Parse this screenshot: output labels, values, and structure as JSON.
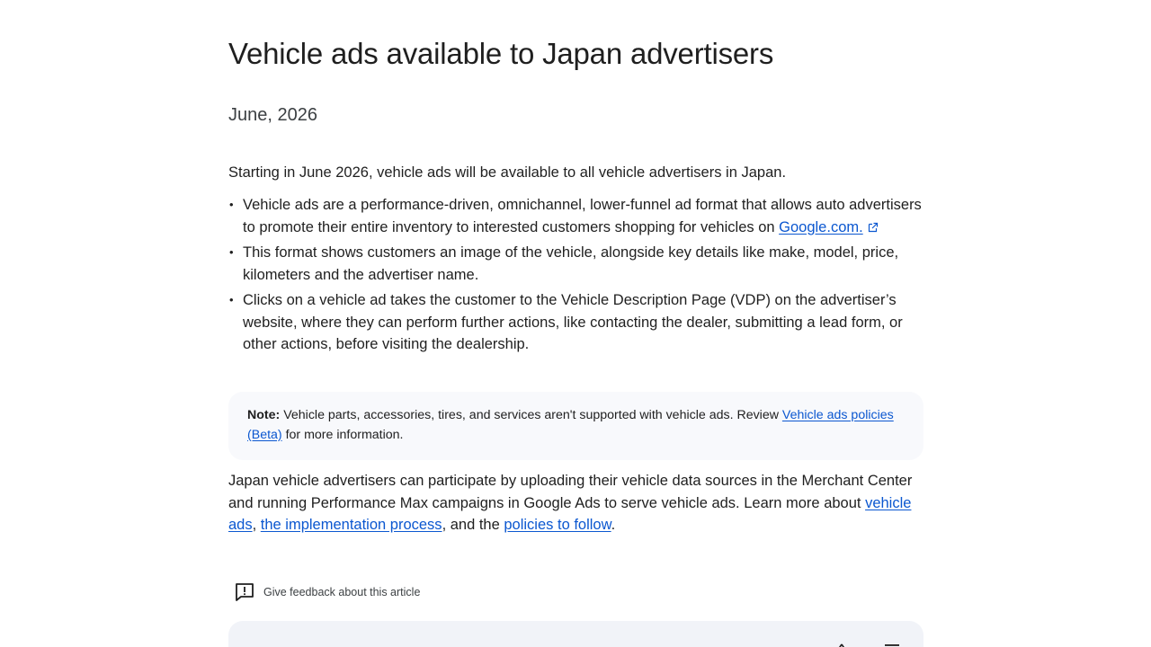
{
  "article": {
    "title": "Vehicle ads available to Japan advertisers",
    "date": "June, 2026",
    "intro": "Starting in June 2026, vehicle ads will be available to all vehicle advertisers in Japan.",
    "bullets": [
      {
        "text": "Vehicle ads are a performance-driven, omnichannel, lower-funnel ad format that allows auto advertisers to promote their entire inventory to interested customers shopping for vehicles on ",
        "link": "Google.com."
      },
      {
        "text": "This format shows customers an image of the vehicle, alongside key details like make, model, price, kilometers and the advertiser name."
      },
      {
        "text": "Clicks on a vehicle ad takes the customer to the Vehicle Description Page (VDP) on the advertiser’s website, where they can perform further actions, like contacting the dealer, submitting a lead form, or other actions, before visiting the dealership."
      }
    ],
    "note": {
      "label": "Note:",
      "text": " Vehicle parts, accessories, tires, and services aren't supported with vehicle ads. Review ",
      "link": "Vehicle ads policies (Beta)",
      "suffix": " for more information."
    },
    "closing": {
      "text1": "Japan vehicle advertisers can participate by uploading their vehicle data sources in the Merchant Center and running Performance Max campaigns in Google Ads to serve vehicle ads. Learn more about ",
      "link1": "vehicle ads",
      "sep1": ", ",
      "link2": "the implementation process",
      "sep2": ", and the ",
      "link3": "policies to follow",
      "end": "."
    }
  },
  "feedback": {
    "label": "Give feedback about this article",
    "icon": "feedback-icon"
  },
  "colors": {
    "link": "#0b57d0",
    "text": "#1f1f1f",
    "note_bg": "#f8f9fc",
    "panel_bg": "#f1f3f8"
  }
}
